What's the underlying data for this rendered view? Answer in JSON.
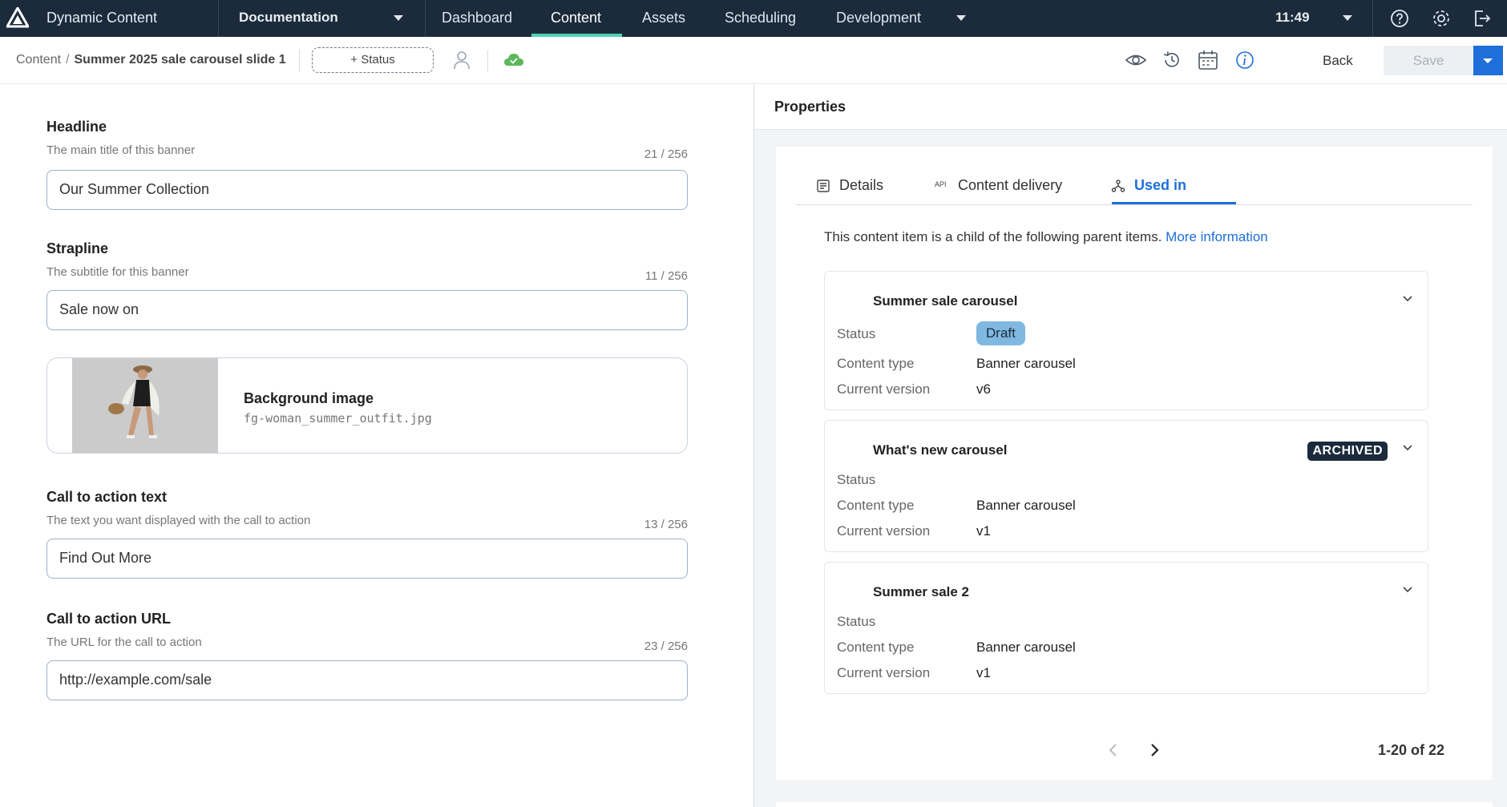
{
  "app": {
    "name": "Dynamic Content",
    "project": "Documentation",
    "clock": "11:49"
  },
  "nav": {
    "tabs": [
      "Dashboard",
      "Content",
      "Assets",
      "Scheduling",
      "Development"
    ],
    "active": "Content"
  },
  "toolbar": {
    "breadcrumb_root": "Content",
    "breadcrumb_current": "Summer 2025 sale carousel slide 1",
    "status_button": "+ Status",
    "back": "Back",
    "save": "Save"
  },
  "form": {
    "headline": {
      "label": "Headline",
      "description": "The main title of this banner",
      "count": "21 / 256",
      "value": "Our Summer Collection"
    },
    "strapline": {
      "label": "Strapline",
      "description": "The subtitle for this banner",
      "count": "11 / 256",
      "value": "Sale now on"
    },
    "background_image": {
      "label": "Background image",
      "filename": "fg-woman_summer_outfit.jpg"
    },
    "cta_text": {
      "label": "Call to action text",
      "description": "The text you want displayed with the call to action",
      "count": "13 / 256",
      "value": "Find Out More"
    },
    "cta_url": {
      "label": "Call to action URL",
      "description": "The URL for the call to action",
      "count": "23 / 256",
      "value": "http://example.com/sale"
    }
  },
  "properties": {
    "title": "Properties",
    "tabs": [
      "Details",
      "Content delivery",
      "Used in"
    ],
    "active_tab": "Used in",
    "tab_icons": [
      "document-icon",
      "api-icon",
      "hierarchy-icon"
    ],
    "api_icon_text": "API",
    "intro": "This content item is a child of the following parent items.",
    "more_info": "More information",
    "field_labels": {
      "status": "Status",
      "content_type": "Content type",
      "current_version": "Current version"
    },
    "parents": [
      {
        "name": "Summer sale carousel",
        "status": "Draft",
        "content_type": "Banner carousel",
        "version": "v6"
      },
      {
        "name": "What's new carousel",
        "badge": "ARCHIVED",
        "content_type": "Banner carousel",
        "version": "v1"
      },
      {
        "name": "Summer sale 2",
        "content_type": "Banner carousel",
        "version": "v1"
      }
    ],
    "pagination": "1-20 of 22"
  },
  "colors": {
    "nav_bg": "#1b2b3c",
    "accent": "#1e6fd9",
    "active_underline": "#4fd3b0",
    "draft_badge": "#7fb8e0",
    "cloud": "#5cb85c"
  }
}
